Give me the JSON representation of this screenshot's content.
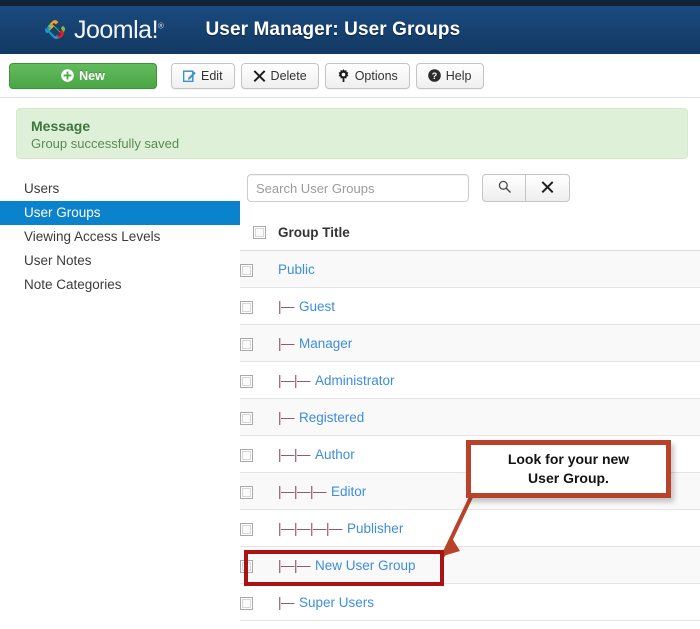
{
  "header": {
    "brand": "Joomla!",
    "brand_trademark": "®",
    "title": "User Manager: User Groups",
    "logo_icon": "joomla-logo-icon"
  },
  "toolbar": {
    "buttons": [
      {
        "label": "New",
        "icon": "plus-circle-icon",
        "style": "primary"
      },
      {
        "label": "Edit",
        "icon": "pencil-square-icon",
        "style": "default"
      },
      {
        "label": "Delete",
        "icon": "x-mark-icon",
        "style": "default"
      },
      {
        "label": "Options",
        "icon": "gear-icon",
        "style": "default"
      },
      {
        "label": "Help",
        "icon": "question-circle-icon",
        "style": "default"
      }
    ]
  },
  "message": {
    "title": "Message",
    "text": "Group successfully saved"
  },
  "sidebar": {
    "items": [
      {
        "label": "Users",
        "active": false
      },
      {
        "label": "User Groups",
        "active": true
      },
      {
        "label": "Viewing Access Levels",
        "active": false
      },
      {
        "label": "User Notes",
        "active": false
      },
      {
        "label": "Note Categories",
        "active": false
      }
    ]
  },
  "search": {
    "placeholder": "Search User Groups",
    "value": "",
    "search_icon": "magnifier-icon",
    "clear_icon": "x-mark-icon"
  },
  "table": {
    "column_header": "Group Title",
    "select_all_name": "select-all-checkbox",
    "rows": [
      {
        "prefix": "",
        "title": "Public"
      },
      {
        "prefix": "|—",
        "title": "Guest"
      },
      {
        "prefix": "|—",
        "title": "Manager"
      },
      {
        "prefix": "|—|—",
        "title": "Administrator"
      },
      {
        "prefix": "|—",
        "title": "Registered"
      },
      {
        "prefix": "|—|—",
        "title": "Author"
      },
      {
        "prefix": "|—|—|—",
        "title": "Editor"
      },
      {
        "prefix": "|—|—|—|—",
        "title": "Publisher"
      },
      {
        "prefix": "|—|—",
        "title": "New User Group"
      },
      {
        "prefix": "|—",
        "title": "Super Users"
      }
    ]
  },
  "annotation": {
    "callout_line_1": "Look for your new",
    "callout_line_2": "User Group.",
    "callout_border_color": "#b8432a",
    "highlight_border_color": "#a81414",
    "arrow_color": "#b8432a"
  },
  "colors": {
    "header_top_strip": "#102337",
    "header_blue": "#16406e",
    "primary_green": "#4ba646",
    "active_blue": "#0b82cc",
    "link_blue": "#3e8ddd",
    "message_bg": "#dff0d8",
    "message_title": "#3c763d",
    "tree_prefix": "#8a4f63"
  }
}
